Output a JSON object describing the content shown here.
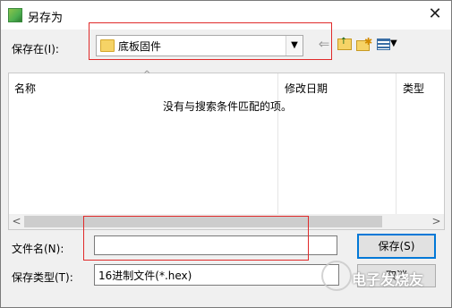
{
  "window": {
    "title": "另存为",
    "close_glyph": "✕"
  },
  "location": {
    "label": "保存在(I):",
    "folder": "底板固件"
  },
  "toolbar": {
    "back_glyph": "⇐",
    "up_glyph": "↑",
    "new_folder_star": "✱",
    "view_dropdown": "▼"
  },
  "list": {
    "columns": [
      "名称",
      "修改日期",
      "类型"
    ],
    "sort_glyph": "^",
    "empty_message": "没有与搜索条件匹配的项。",
    "scroll_left": "<",
    "scroll_right": ">"
  },
  "form": {
    "filename_label": "文件名(N):",
    "filename_value": "",
    "filetype_label": "保存类型(T):",
    "filetype_value": "16进制文件(*.hex)",
    "save_button": "保存(S)",
    "cancel_button": "取消"
  },
  "watermark": {
    "text": "电子发烧友"
  },
  "colors": {
    "highlight_box": "#e02a2a",
    "accent": "#0078d7"
  }
}
